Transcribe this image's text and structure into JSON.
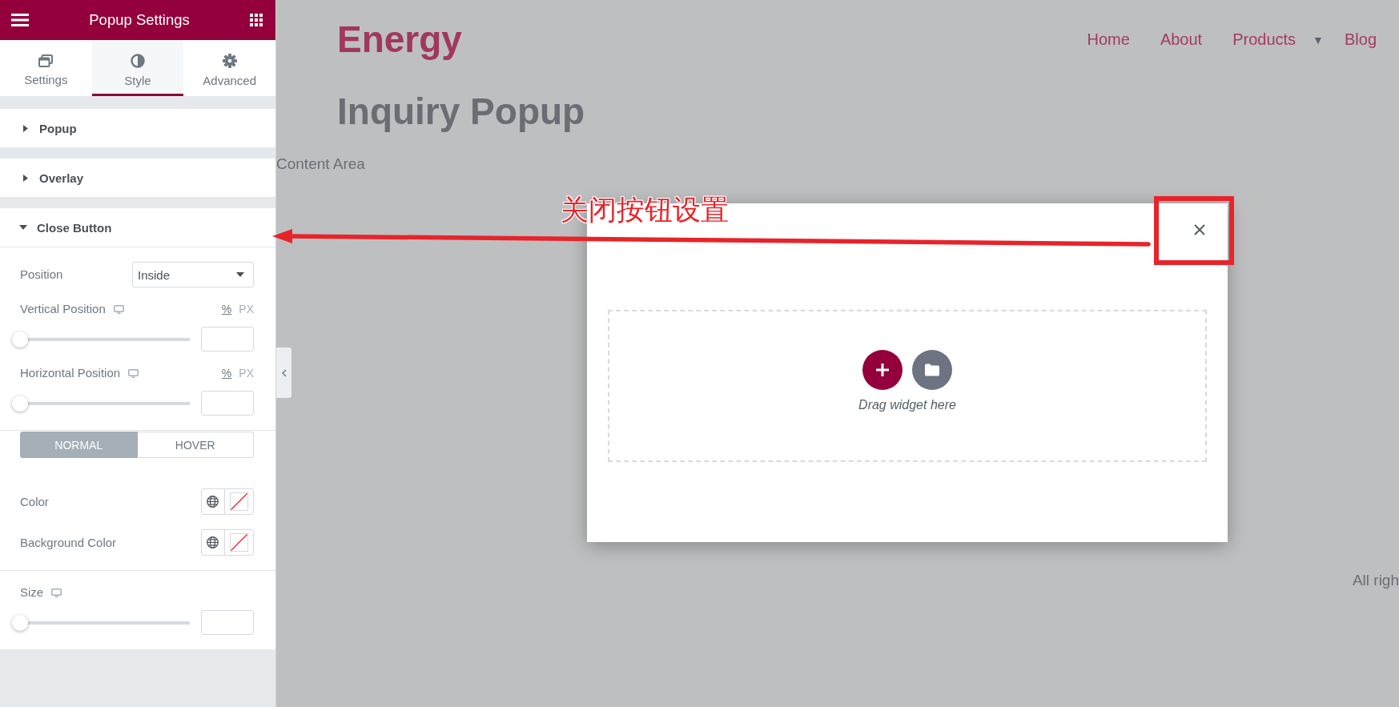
{
  "panel": {
    "title": "Popup Settings",
    "tabs": [
      {
        "label": "Settings",
        "selected": false
      },
      {
        "label": "Style",
        "selected": true
      },
      {
        "label": "Advanced",
        "selected": false
      }
    ],
    "sections": [
      {
        "title": "Popup",
        "expanded": false
      },
      {
        "title": "Overlay",
        "expanded": false
      },
      {
        "title": "Close Button",
        "expanded": true,
        "groups": [
          {
            "controls": [
              {
                "kind": "select",
                "label": "Position",
                "value": "Inside"
              },
              {
                "kind": "slider",
                "label": "Vertical Position",
                "responsive": true,
                "units": [
                  {
                    "label": "%",
                    "selected": true
                  },
                  {
                    "label": "PX",
                    "selected": false
                  }
                ],
                "level": 0
              },
              {
                "kind": "slider",
                "label": "Horizontal Position",
                "responsive": true,
                "units": [
                  {
                    "label": "%",
                    "selected": true
                  },
                  {
                    "label": "PX",
                    "selected": false
                  }
                ],
                "level": 0
              }
            ]
          },
          {
            "controls": [
              {
                "kind": "toggle",
                "options": [
                  {
                    "label": "NORMAL",
                    "selected": true
                  },
                  {
                    "label": "HOVER",
                    "selected": false
                  }
                ]
              },
              {
                "kind": "color",
                "label": "Color"
              },
              {
                "kind": "color",
                "label": "Background Color"
              }
            ]
          },
          {
            "controls": [
              {
                "kind": "slider",
                "label": "Size",
                "responsive": true,
                "level": 0
              }
            ]
          }
        ]
      }
    ]
  },
  "page": {
    "site_title": "Energy",
    "nav": [
      {
        "label": "Home"
      },
      {
        "label": "About"
      },
      {
        "label": "Products",
        "caret": "▼"
      },
      {
        "label": "Blog"
      }
    ],
    "title": "Inquiry Popup",
    "content_label": "Content Area",
    "footer_text": "All righ"
  },
  "popup": {
    "drop_hint": "Drag widget here"
  },
  "annotation": {
    "text": "关闭按钮设置"
  }
}
